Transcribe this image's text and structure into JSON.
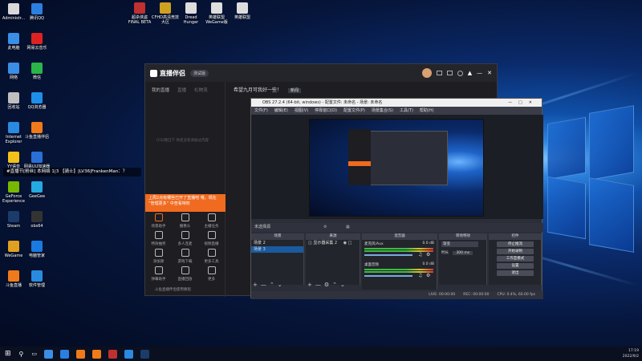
{
  "desktop_icons": [
    {
      "label": "Administr...",
      "color": "#d8d8d8"
    },
    {
      "label": "腾讯QQ",
      "color": "#2a7fe0"
    },
    {
      "label": "此电脑",
      "color": "#3a8ee6"
    },
    {
      "label": "网易云音乐",
      "color": "#d22"
    },
    {
      "label": "网络",
      "color": "#3a8ee6"
    },
    {
      "label": "微信",
      "color": "#2ab44a"
    },
    {
      "label": "回收站",
      "color": "#bfbfbf"
    },
    {
      "label": "QQ浏览器",
      "color": "#1e8fe8"
    },
    {
      "label": "Internet Explorer",
      "color": "#2a8ae0"
    },
    {
      "label": "斗鱼直播伴侣",
      "color": "#f07a1a"
    },
    {
      "label": "YY语音",
      "color": "#f2c21a"
    },
    {
      "label": "网易UU加速器",
      "color": "#2a6fd6"
    },
    {
      "label": "GeForce Experience",
      "color": "#76b900"
    },
    {
      "label": "GeeGee",
      "color": "#26a8e0"
    },
    {
      "label": "Steam",
      "color": "#1b3c6a"
    },
    {
      "label": "obs64",
      "color": "#333"
    },
    {
      "label": "WeGame",
      "color": "#e0a020"
    },
    {
      "label": "电脑管家",
      "color": "#1a7ae0"
    },
    {
      "label": "斗鱼直播",
      "color": "#f07a1a"
    },
    {
      "label": "软件管理",
      "color": "#2a8ae0"
    }
  ],
  "top_icons": [
    {
      "label": "超杀侠盗 FINAL BETA",
      "color": "#c03030"
    },
    {
      "label": "CFHD高清竞技大区",
      "color": "#d0a020"
    },
    {
      "label": "Dread Hunger",
      "color": "#ddd"
    },
    {
      "label": "英雄联盟 WeGame版",
      "color": "#ddd"
    },
    {
      "label": "英雄联盟",
      "color": "#ddd"
    }
  ],
  "chat_line": "#直播节[粉丝]   本网络 1|3 【骑士】|LV36|FrankenMan：？",
  "live_companion": {
    "app_name": "直播伴侣",
    "version_badge": "测试版",
    "tabs": [
      "我的直播",
      "直播",
      "礼物流"
    ],
    "message": "希望九月可我好一些！",
    "message_tag": "新闻",
    "hint": "(CS)我已下 你还没有添加过内容",
    "promo": "上周2点有哪些已开了直播吧 哦，现在 ”管理更多“ 中查看特权",
    "grid": [
      {
        "label": "场景助手"
      },
      {
        "label": "摄像头"
      },
      {
        "label": "主播任务"
      },
      {
        "label": "特效抽奖"
      },
      {
        "label": "多人连麦"
      },
      {
        "label": "视频直播"
      },
      {
        "label": "添加源"
      },
      {
        "label": "游戏下载"
      },
      {
        "label": "更多工具"
      },
      {
        "label": "弹幕助手"
      },
      {
        "label": "直播回放"
      },
      {
        "label": "更多"
      }
    ],
    "footer": "斗鱼直播伴侣使用教程"
  },
  "obs": {
    "title": "OBS 27.2.4 (64-bit, windows) - 配置文件: 未命名 - 场景: 未命名",
    "menu": [
      "文件(F)",
      "编辑(E)",
      "视图(V)",
      "停靠窗口(D)",
      "配置文件(P)",
      "场景集合(S)",
      "工具(T)",
      "帮助(H)"
    ],
    "source_toolbar": "未选择源",
    "scene_header": "场景",
    "scenes": [
      {
        "name": "场景 2",
        "selected": false
      },
      {
        "name": "场景 3",
        "selected": true
      }
    ],
    "sources_header": "来源",
    "sources": [
      "显示器采集 2"
    ],
    "mixer_header": "混音器",
    "mixer": [
      {
        "name": "麦克风/Aux",
        "db": "0.0 dB"
      },
      {
        "name": "桌面音频",
        "db": "0.0 dB"
      }
    ],
    "transition_header": "转场特效",
    "transition": "渐变",
    "duration_label": "时长",
    "duration_value": "300 ms",
    "controls_header": "控件",
    "controls": [
      "停止推流",
      "开始录制",
      "工作室模式",
      "设置",
      "退出"
    ],
    "status": [
      "LIVE: 00:00:00",
      "REC: 00:00:00",
      "CPU: 0.4%, 60.00 fps"
    ]
  },
  "taskbar": {
    "time": "17:19",
    "date": "2022/9/2",
    "icons": [
      "#3a8ee6",
      "#2a7fe0",
      "#f07a1a",
      "#f07a1a",
      "#c03030",
      "#2a8ae0",
      "#1b3c6a"
    ]
  }
}
